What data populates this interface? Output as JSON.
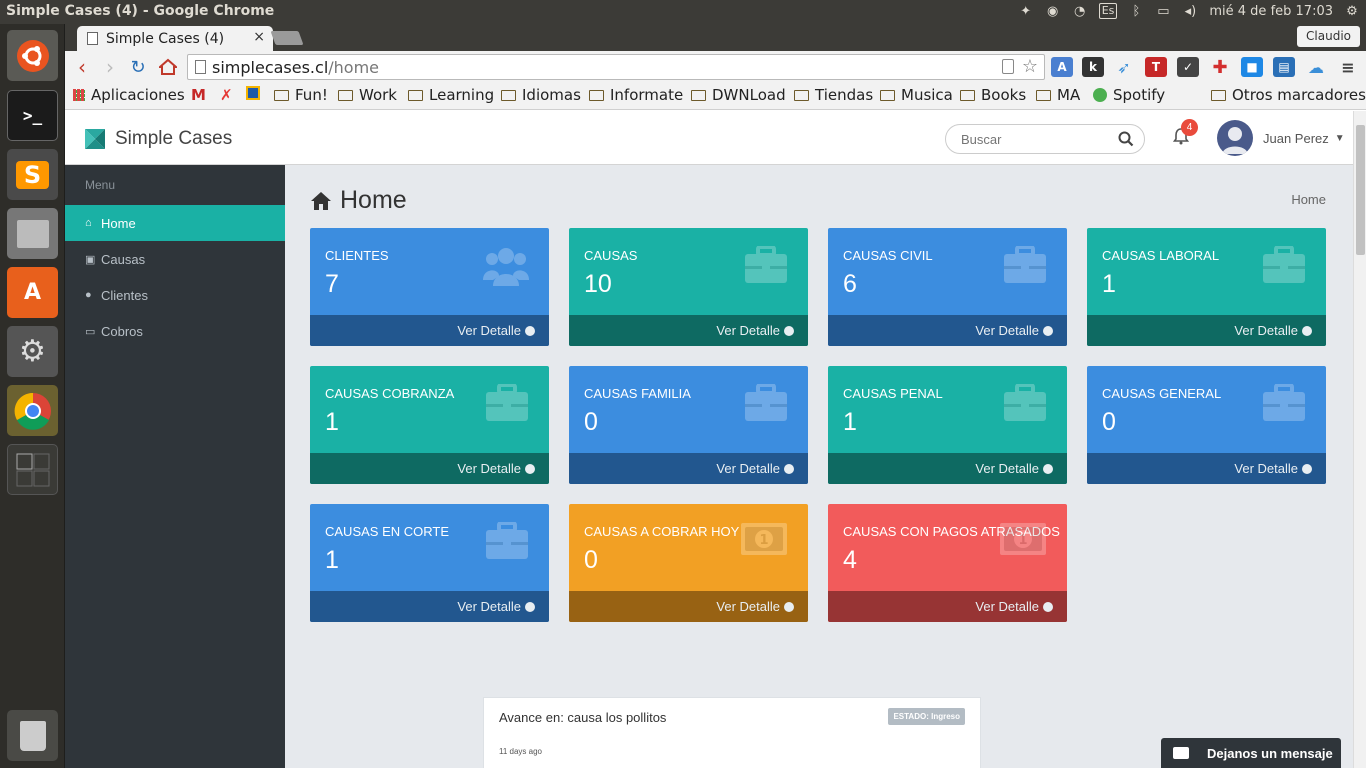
{
  "os": {
    "window_title": "Simple Cases (4) - Google Chrome",
    "keyboard_layout": "Es",
    "clock": "mié 4 de feb 17:03"
  },
  "browser": {
    "tab_title": "Simple Cases (4)",
    "tab_close": "×",
    "profile": "Claudio",
    "url_host": "simplecases.cl",
    "url_path": "/home",
    "bookmarks": [
      {
        "label": "Aplicaciones",
        "icon": "apps-grid-icon"
      },
      {
        "label": "",
        "icon": "gmail-icon"
      },
      {
        "label": "",
        "icon": "x-icon"
      },
      {
        "label": "",
        "icon": "bookmark-site-icon"
      },
      {
        "label": "Fun!",
        "icon": "folder-icon"
      },
      {
        "label": "Work",
        "icon": "folder-icon"
      },
      {
        "label": "Learning",
        "icon": "folder-icon"
      },
      {
        "label": "Idiomas",
        "icon": "folder-icon"
      },
      {
        "label": "Informate",
        "icon": "folder-icon"
      },
      {
        "label": "DWNLoad",
        "icon": "folder-icon"
      },
      {
        "label": "Tiendas",
        "icon": "folder-icon"
      },
      {
        "label": "Musica",
        "icon": "folder-icon"
      },
      {
        "label": "Books",
        "icon": "folder-icon"
      },
      {
        "label": "MA",
        "icon": "folder-icon"
      },
      {
        "label": "Spotify",
        "icon": "spotify-icon"
      }
    ],
    "other_bookmarks": "Otros marcadores"
  },
  "app": {
    "brand": "Simple Cases",
    "search_placeholder": "Buscar",
    "notification_count": "4",
    "user_name": "Juan Perez",
    "menu_label": "Menu",
    "sidebar": [
      {
        "label": "Home",
        "icon": "home-icon",
        "active": true
      },
      {
        "label": "Causas",
        "icon": "briefcase-icon",
        "active": false
      },
      {
        "label": "Clientes",
        "icon": "users-icon",
        "active": false
      },
      {
        "label": "Cobros",
        "icon": "money-icon",
        "active": false
      }
    ],
    "page_title": "Home",
    "breadcrumb": "Home",
    "footer_link": "Ver Detalle",
    "cards": [
      {
        "label": "CLIENTES",
        "value": "7",
        "color": "blue",
        "icon": "users-icon"
      },
      {
        "label": "CAUSAS",
        "value": "10",
        "color": "teal",
        "icon": "briefcase-icon"
      },
      {
        "label": "CAUSAS CIVIL",
        "value": "6",
        "color": "blue",
        "icon": "briefcase-icon"
      },
      {
        "label": "CAUSAS LABORAL",
        "value": "1",
        "color": "teal",
        "icon": "briefcase-icon"
      },
      {
        "label": "CAUSAS COBRANZA",
        "value": "1",
        "color": "teal",
        "icon": "briefcase-icon"
      },
      {
        "label": "CAUSAS FAMILIA",
        "value": "0",
        "color": "blue",
        "icon": "briefcase-icon"
      },
      {
        "label": "CAUSAS PENAL",
        "value": "1",
        "color": "teal",
        "icon": "briefcase-icon"
      },
      {
        "label": "CAUSAS GENERAL",
        "value": "0",
        "color": "blue",
        "icon": "briefcase-icon"
      },
      {
        "label": "CAUSAS EN CORTE",
        "value": "1",
        "color": "blue",
        "icon": "briefcase-icon"
      },
      {
        "label": "CAUSAS A COBRAR HOY",
        "value": "0",
        "color": "orange",
        "icon": "money-icon"
      },
      {
        "label": "CAUSAS CON PAGOS ATRASADOS",
        "value": "4",
        "color": "red",
        "icon": "money-icon"
      }
    ],
    "activity": {
      "title": "Avance en: causa los pollitos",
      "status": "ESTADO: Ingreso",
      "time": "11 days ago"
    },
    "chat_label": "Dejanos un mensaje"
  },
  "colors": {
    "blue": "#3c8ddf",
    "teal": "#1ab1a5",
    "orange": "#f2a024",
    "red": "#f25b5b",
    "sidebar": "#2f353a"
  }
}
